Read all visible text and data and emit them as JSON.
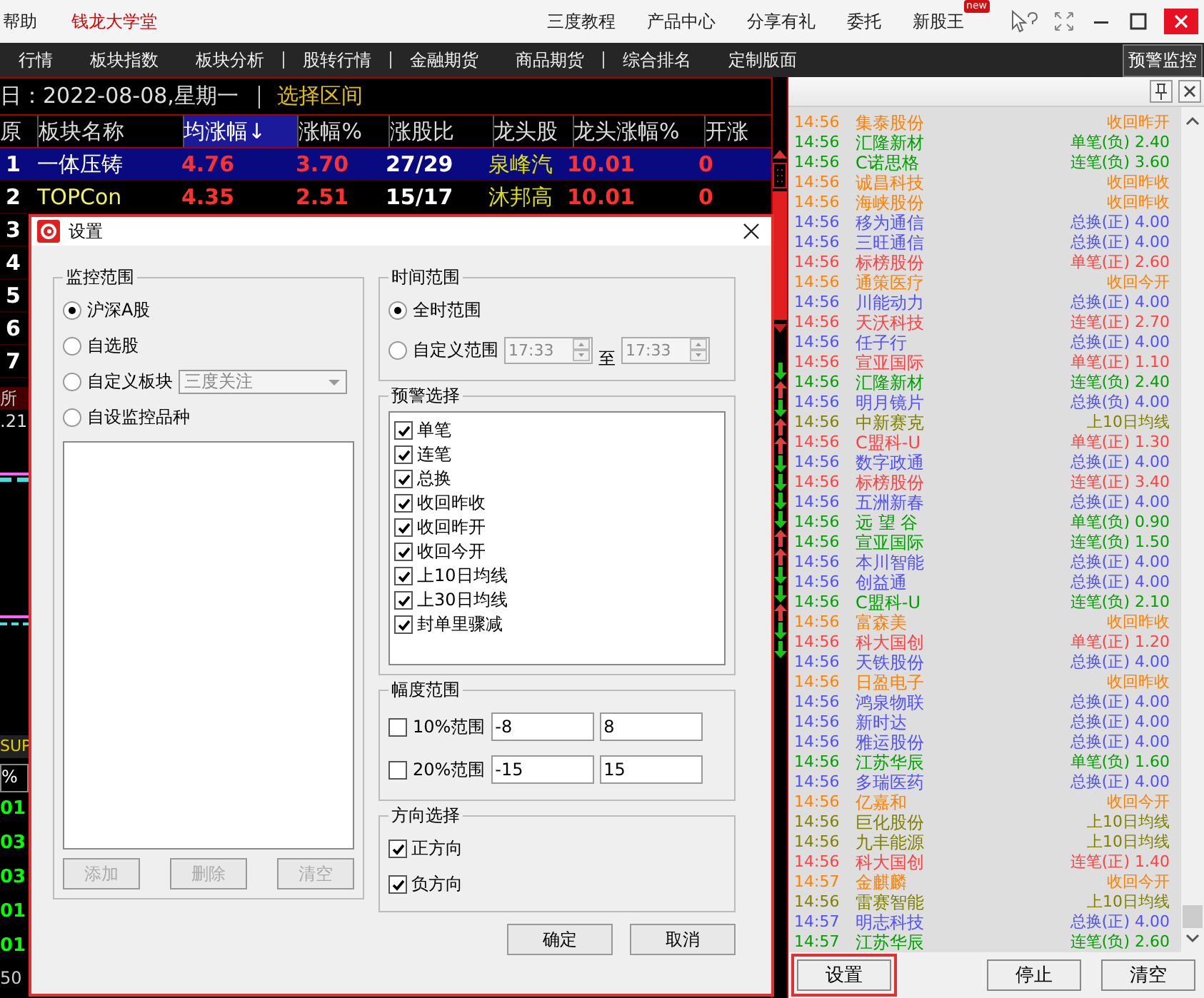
{
  "top_bar": {
    "left_items": [
      {
        "label": "帮助",
        "kind": "plain"
      },
      {
        "label": "钱龙大学堂",
        "kind": "highlight"
      }
    ],
    "menu": [
      {
        "label": "三度教程"
      },
      {
        "label": "产品中心"
      },
      {
        "label": "分享有礼"
      },
      {
        "label": "委托"
      },
      {
        "label": "新股王",
        "badge": "new"
      }
    ]
  },
  "nav": {
    "items": [
      {
        "label": "行情",
        "separator_after": false
      },
      {
        "label": "板块指数",
        "separator_after": false
      },
      {
        "label": "板块分析",
        "separator_after": true
      },
      {
        "label": "股转行情",
        "separator_after": true
      },
      {
        "label": "金融期货",
        "separator_after": false
      },
      {
        "label": "商品期货",
        "separator_after": true
      },
      {
        "label": "综合排名",
        "separator_after": false
      },
      {
        "label": "定制版面",
        "separator_after": false
      }
    ],
    "monitor_button": "预警监控"
  },
  "board": {
    "date": "日：2022-08-08,星期一",
    "range_link": "选择区间",
    "columns": [
      "原",
      "板块名称",
      "均涨幅↓",
      "涨幅%",
      "涨股比",
      "龙头股",
      "龙头涨幅%",
      "开涨"
    ],
    "rows": [
      {
        "index": "1",
        "cells": [
          "一体压铸",
          "4.76",
          "3.70",
          "27/29",
          "泉峰汽",
          "10.01",
          "0"
        ],
        "selected": true
      },
      {
        "index": "2",
        "cells": [
          "TOPCon",
          "4.35",
          "2.51",
          "15/17",
          "沐邦高",
          "10.01",
          "0"
        ],
        "selected": false
      },
      {
        "index": "3",
        "selected": false
      },
      {
        "index": "4",
        "selected": false
      },
      {
        "index": "5",
        "selected": false
      },
      {
        "index": "6",
        "selected": false
      },
      {
        "index": "7",
        "selected": false
      }
    ],
    "fragments": [
      {
        "text": "所",
        "kind": "tab"
      },
      {
        "text": ".21",
        "kind": "value"
      },
      {
        "text": "SUP",
        "kind": "label"
      },
      {
        "text": "%",
        "kind": "header"
      },
      {
        "text": "01",
        "kind": "green"
      },
      {
        "text": "03",
        "kind": "green"
      },
      {
        "text": "03",
        "kind": "green"
      },
      {
        "text": "01",
        "kind": "green"
      },
      {
        "text": "01",
        "kind": "green"
      },
      {
        "text": "50",
        "kind": "value"
      }
    ]
  },
  "trend_arrows": [
    {
      "kind": "down"
    },
    {
      "kind": "up"
    },
    {
      "kind": "down"
    },
    {
      "kind": "up"
    },
    {
      "kind": "up"
    },
    {
      "kind": "down"
    },
    {
      "kind": "down"
    },
    {
      "kind": "down"
    },
    {
      "kind": "down"
    },
    {
      "kind": "up"
    },
    {
      "kind": "up"
    },
    {
      "kind": "down"
    },
    {
      "kind": "down"
    },
    {
      "kind": "up"
    },
    {
      "kind": "down"
    },
    {
      "kind": "down"
    }
  ],
  "alerts": [
    {
      "time": "14:56",
      "name": "集泰股份",
      "event": "收回昨开",
      "color": "#ff8000"
    },
    {
      "time": "14:56",
      "name": "汇隆新材",
      "event": "单笔(负) 2.40",
      "color": "#00a000"
    },
    {
      "time": "14:56",
      "name": "C诺思格",
      "event": "连笔(负) 3.60",
      "color": "#00a000"
    },
    {
      "time": "14:56",
      "name": "诚昌科技",
      "event": "收回昨收",
      "color": "#ff8000"
    },
    {
      "time": "14:56",
      "name": "海峡股份",
      "event": "收回昨收",
      "color": "#ff8000"
    },
    {
      "time": "14:56",
      "name": "移为通信",
      "event": "总换(正) 4.00",
      "color": "#5050ff"
    },
    {
      "time": "14:56",
      "name": "三旺通信",
      "event": "总换(正) 4.00",
      "color": "#5050ff"
    },
    {
      "time": "14:56",
      "name": "标榜股份",
      "event": "单笔(正) 2.60",
      "color": "#ff4040"
    },
    {
      "time": "14:56",
      "name": "通策医疗",
      "event": "收回今开",
      "color": "#ff8000"
    },
    {
      "time": "14:56",
      "name": "川能动力",
      "event": "总换(正) 4.00",
      "color": "#5050ff"
    },
    {
      "time": "14:56",
      "name": "天沃科技",
      "event": "连笔(正) 2.70",
      "color": "#ff4040"
    },
    {
      "time": "14:56",
      "name": "任子行",
      "event": "总换(正) 4.00",
      "color": "#5050ff"
    },
    {
      "time": "14:56",
      "name": "宣亚国际",
      "event": "单笔(正) 1.10",
      "color": "#ff4040"
    },
    {
      "time": "14:56",
      "name": "汇隆新材",
      "event": "连笔(负) 2.40",
      "color": "#00a000"
    },
    {
      "time": "14:56",
      "name": "明月镜片",
      "event": "总换(负) 4.00",
      "color": "#5050ff"
    },
    {
      "time": "14:56",
      "name": "中新赛克",
      "event": "上10日均线",
      "color": "#808000"
    },
    {
      "time": "14:56",
      "name": "C盟科-U",
      "event": "单笔(正) 1.30",
      "color": "#ff4040"
    },
    {
      "time": "14:56",
      "name": "数字政通",
      "event": "总换(正) 4.00",
      "color": "#5050ff"
    },
    {
      "time": "14:56",
      "name": "标榜股份",
      "event": "连笔(正) 3.40",
      "color": "#ff4040"
    },
    {
      "time": "14:56",
      "name": "五洲新春",
      "event": "总换(正) 4.00",
      "color": "#5050ff"
    },
    {
      "time": "14:56",
      "name": "远 望 谷",
      "event": "单笔(负) 0.90",
      "color": "#00a000"
    },
    {
      "time": "14:56",
      "name": "宣亚国际",
      "event": "连笔(负) 1.50",
      "color": "#00a000"
    },
    {
      "time": "14:56",
      "name": "本川智能",
      "event": "总换(正) 4.00",
      "color": "#5050ff"
    },
    {
      "time": "14:56",
      "name": "创益通",
      "event": "总换(正) 4.00",
      "color": "#5050ff"
    },
    {
      "time": "14:56",
      "name": "C盟科-U",
      "event": "连笔(负) 2.10",
      "color": "#00a000"
    },
    {
      "time": "14:56",
      "name": "富森美",
      "event": "收回昨收",
      "color": "#ff8000"
    },
    {
      "time": "14:56",
      "name": "科大国创",
      "event": "单笔(正) 1.20",
      "color": "#ff4040"
    },
    {
      "time": "14:56",
      "name": "天铁股份",
      "event": "总换(正) 4.00",
      "color": "#5050ff"
    },
    {
      "time": "14:56",
      "name": "日盈电子",
      "event": "收回昨收",
      "color": "#ff8000"
    },
    {
      "time": "14:56",
      "name": "鸿泉物联",
      "event": "总换(正) 4.00",
      "color": "#5050ff"
    },
    {
      "time": "14:56",
      "name": "新时达",
      "event": "总换(正) 4.00",
      "color": "#5050ff"
    },
    {
      "time": "14:56",
      "name": "雅运股份",
      "event": "总换(正) 4.00",
      "color": "#5050ff"
    },
    {
      "time": "14:56",
      "name": "江苏华辰",
      "event": "单笔(负) 1.60",
      "color": "#00a000"
    },
    {
      "time": "14:56",
      "name": "多瑞医药",
      "event": "总换(正) 4.00",
      "color": "#5050ff"
    },
    {
      "time": "14:56",
      "name": "亿嘉和",
      "event": "收回今开",
      "color": "#ff8000"
    },
    {
      "time": "14:56",
      "name": "巨化股份",
      "event": "上10日均线",
      "color": "#808000"
    },
    {
      "time": "14:56",
      "name": "九丰能源",
      "event": "上10日均线",
      "color": "#808000"
    },
    {
      "time": "14:56",
      "name": "科大国创",
      "event": "连笔(正) 1.40",
      "color": "#ff4040"
    },
    {
      "time": "14:57",
      "name": "金麒麟",
      "event": "收回今开",
      "color": "#ff8000"
    },
    {
      "time": "14:56",
      "name": "雷赛智能",
      "event": "上10日均线",
      "color": "#808000"
    },
    {
      "time": "14:57",
      "name": "明志科技",
      "event": "总换(正) 4.00",
      "color": "#5050ff"
    },
    {
      "time": "14:57",
      "name": "江苏华辰",
      "event": "连笔(负) 2.60",
      "color": "#00a000"
    }
  ],
  "panel_buttons": [
    {
      "label": "设置",
      "highlighted": true
    },
    {
      "label": "停止",
      "highlighted": false
    },
    {
      "label": "清空",
      "highlighted": false
    }
  ],
  "dialog": {
    "title": "设置",
    "scope": {
      "legend": "监控范围",
      "options": [
        {
          "label": "沪深A股",
          "selected": true
        },
        {
          "label": "自选股",
          "selected": false
        },
        {
          "label": "自定义板块",
          "selected": false,
          "dropdown": "三度关注"
        },
        {
          "label": "自设监控品种",
          "selected": false
        }
      ],
      "buttons": [
        {
          "label": "添加",
          "disabled": true
        },
        {
          "label": "删除",
          "disabled": true
        },
        {
          "label": "清空",
          "disabled": true
        }
      ]
    },
    "time": {
      "legend": "时间范围",
      "options": [
        {
          "label": "全时范围",
          "selected": true
        },
        {
          "label": "自定义范围",
          "selected": false
        }
      ],
      "from": "17:33",
      "to_label": "至",
      "to": "17:33"
    },
    "alerts": {
      "legend": "预警选择",
      "items": [
        {
          "label": "单笔",
          "checked": true
        },
        {
          "label": "连笔",
          "checked": true
        },
        {
          "label": "总换",
          "checked": true
        },
        {
          "label": "收回昨收",
          "checked": true
        },
        {
          "label": "收回昨开",
          "checked": true
        },
        {
          "label": "收回今开",
          "checked": true
        },
        {
          "label": "上10日均线",
          "checked": true
        },
        {
          "label": "上30日均线",
          "checked": true
        },
        {
          "label": "封单里骤减",
          "checked": true
        }
      ]
    },
    "amplitude": {
      "legend": "幅度范围",
      "rows": [
        {
          "label": "10%范围",
          "checked": false,
          "low": "-8",
          "high": "8"
        },
        {
          "label": "20%范围",
          "checked": false,
          "low": "-15",
          "high": "15"
        }
      ]
    },
    "direction": {
      "legend": "方向选择",
      "items": [
        {
          "label": "正方向",
          "checked": true
        },
        {
          "label": "负方向",
          "checked": true
        }
      ]
    },
    "buttons": [
      "确定",
      "取消"
    ]
  }
}
